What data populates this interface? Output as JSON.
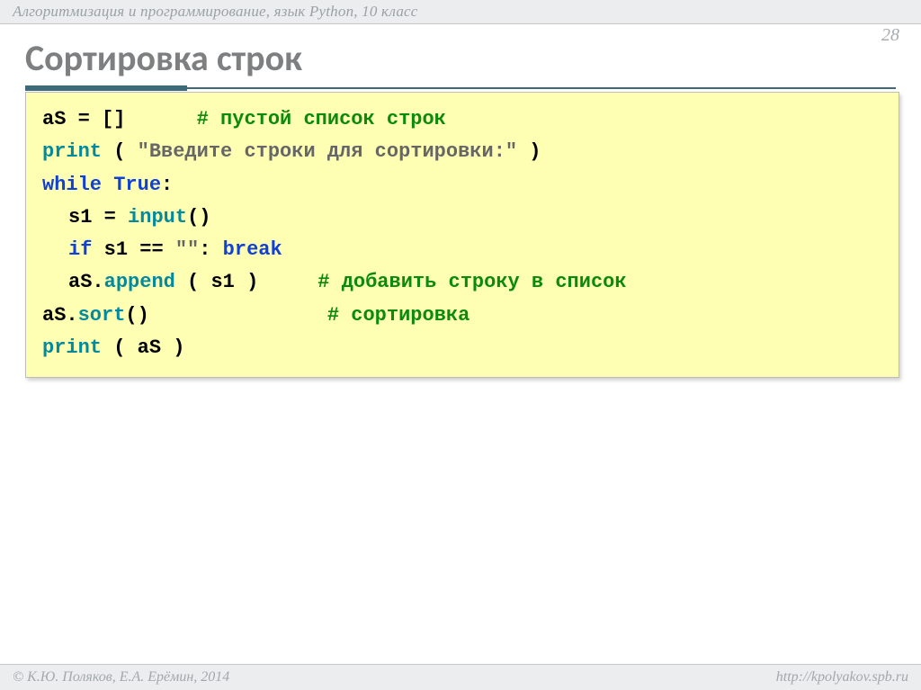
{
  "header": {
    "breadcrumb": "Алгоритмизация и программирование, язык Python, 10 класс"
  },
  "page_number": "28",
  "title": "Сортировка строк",
  "code": {
    "l1": {
      "a": "aS",
      "b": " = []",
      "pad": "      ",
      "c": "# пустой список строк"
    },
    "l2": {
      "a": "print",
      "b": " ( ",
      "c": "\"Введите строки для сортировки:\"",
      "d": " )"
    },
    "l3": {
      "a": "while",
      "b": " ",
      "c": "True",
      "d": ":"
    },
    "l4": {
      "a": "s1 = ",
      "b": "input",
      "c": "()"
    },
    "l5": {
      "a": "if",
      "b": " s1 == ",
      "c": "\"\"",
      "d": ": ",
      "e": "break"
    },
    "l6": {
      "a": "aS.",
      "b": "append",
      "c": " ( s1 )",
      "pad": "     ",
      "d": "# добавить строку в список"
    },
    "l7": {
      "a": "aS.",
      "b": "sort",
      "c": "()",
      "pad": "               ",
      "d": "# сортировка"
    },
    "l8": {
      "a": "print",
      "b": " ( aS )"
    }
  },
  "footer": {
    "left": "© К.Ю. Поляков, Е.А. Ерёмин, 2014",
    "right": "http://kpolyakov.spb.ru"
  }
}
